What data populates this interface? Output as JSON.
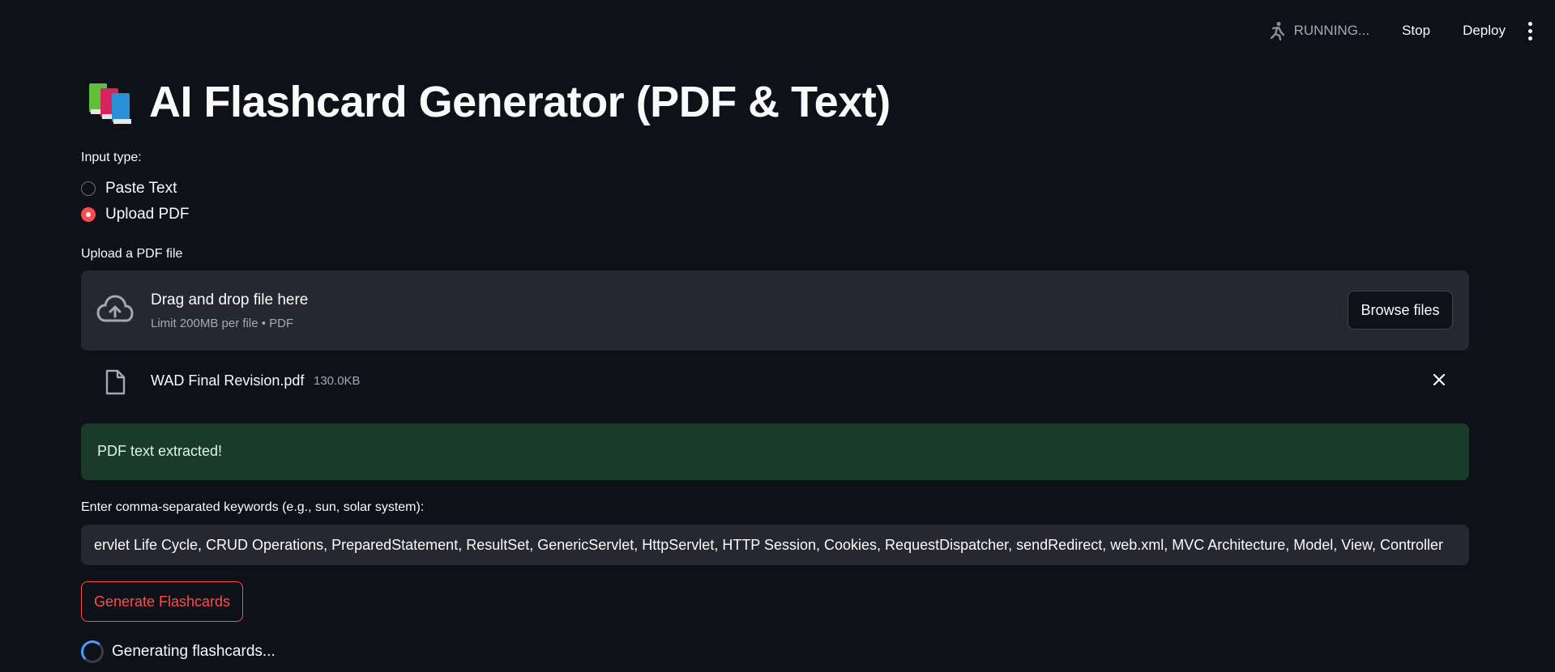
{
  "toolbar": {
    "status": "RUNNING...",
    "stop_label": "Stop",
    "deploy_label": "Deploy"
  },
  "page": {
    "title": "AI Flashcard Generator (PDF & Text)"
  },
  "input_type": {
    "label": "Input type:",
    "options": [
      "Paste Text",
      "Upload PDF"
    ],
    "selected": "Upload PDF"
  },
  "uploader": {
    "label": "Upload a PDF file",
    "drop_title": "Drag and drop file here",
    "drop_subtitle": "Limit 200MB per file • PDF",
    "browse_label": "Browse files",
    "file": {
      "name": "WAD Final Revision.pdf",
      "size": "130.0KB"
    }
  },
  "alert": {
    "success_text": "PDF text extracted!"
  },
  "keywords": {
    "label": "Enter comma-separated keywords (e.g., sun, solar system):",
    "value": "ervlet Life Cycle, CRUD Operations, PreparedStatement, ResultSet, GenericServlet, HttpServlet, HTTP Session, Cookies, RequestDispatcher, sendRedirect, web.xml, MVC Architecture, Model, View, Controller"
  },
  "actions": {
    "generate_label": "Generate Flashcards",
    "progress_text": "Generating flashcards..."
  },
  "colors": {
    "background": "#0e1117",
    "accent": "#ff4b4b",
    "success_bg": "#1b3b2a",
    "input_bg": "#262730"
  }
}
